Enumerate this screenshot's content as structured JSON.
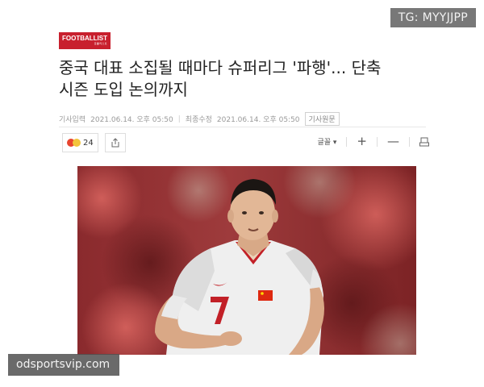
{
  "watermarks": {
    "top": "TG: MYYJJPP",
    "bottom": "odsportsvip.com"
  },
  "article": {
    "brand": "FOOTBALLIST",
    "brand_sub": "풋볼리스트",
    "headline_line1": "중국 대표 소집될 때마다 슈퍼리그 '파행'... 단축",
    "headline_line2": "시즌 도입 논의까지",
    "published_label": "기사입력",
    "published_time": "2021.06.14. 오후 05:50",
    "modified_label": "최종수정",
    "modified_time": "2021.06.14. 오후 05:50",
    "original_link": "기사원문"
  },
  "toolbar": {
    "reaction_count": "24",
    "font_label": "글꼴"
  },
  "colors": {
    "brand_red": "#c8202e",
    "jersey": "#f1f1f1",
    "jersey_accent": "#cc1c24"
  }
}
